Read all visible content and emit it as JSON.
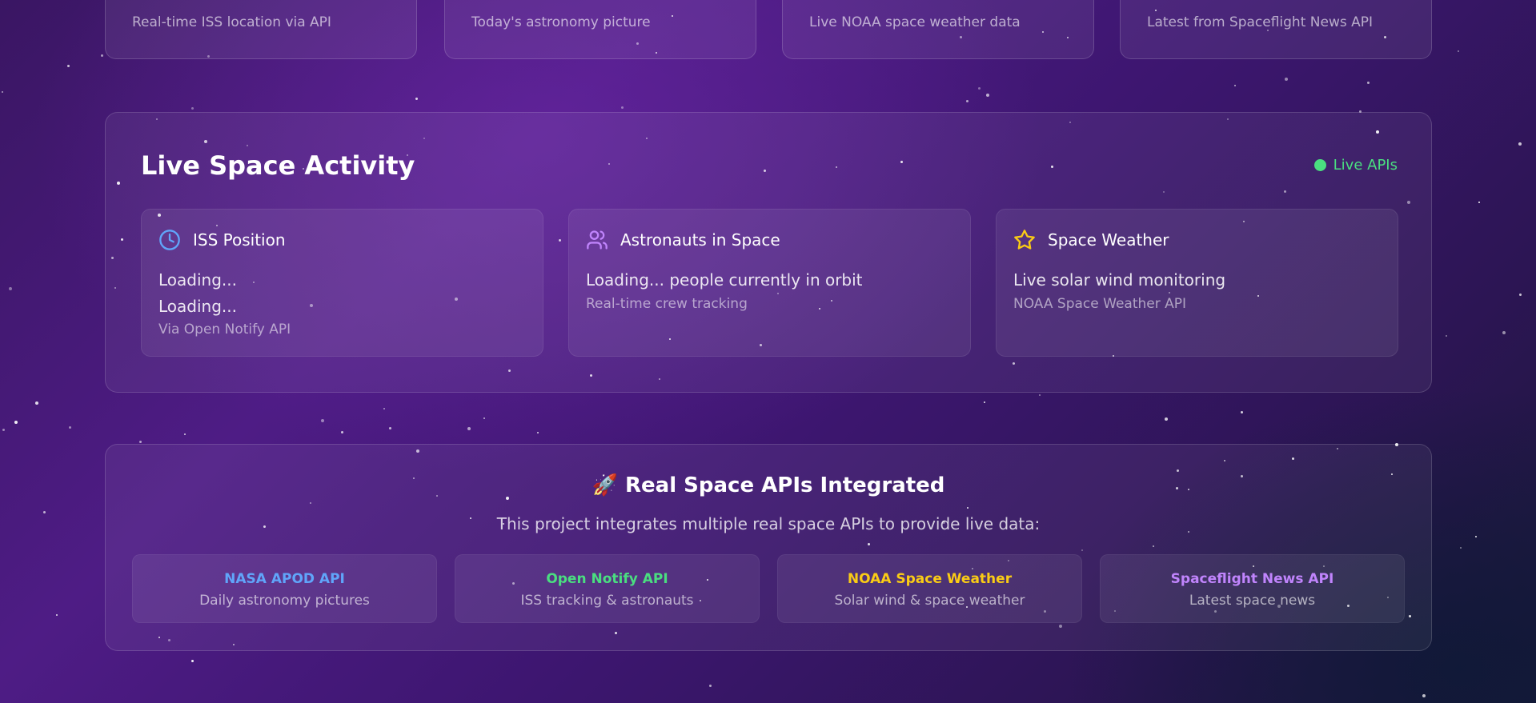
{
  "top_cards": [
    {
      "text": "Real-time ISS location via API"
    },
    {
      "text": "Today's astronomy picture"
    },
    {
      "text": "Live NOAA space weather data"
    },
    {
      "text": "Latest from Spaceflight News API"
    }
  ],
  "activity": {
    "title": "Live Space Activity",
    "badge_label": "Live APIs",
    "badge_color": "#4ade80",
    "cards": [
      {
        "icon": "clock-icon",
        "icon_color": "#60a5fa",
        "title": "ISS Position",
        "line1": "Loading...",
        "line2": "Loading...",
        "source": "Via Open Notify API"
      },
      {
        "icon": "users-icon",
        "icon_color": "#c084fc",
        "title": "Astronauts in Space",
        "line1": "Loading... people currently in orbit",
        "source": "Real-time crew tracking"
      },
      {
        "icon": "star-icon",
        "icon_color": "#facc15",
        "title": "Space Weather",
        "line1": "Live solar wind monitoring",
        "source": "NOAA Space Weather API"
      }
    ]
  },
  "apis": {
    "emoji": "🚀",
    "title": "Real Space APIs Integrated",
    "description": "This project integrates multiple real space APIs to provide live data:",
    "items": [
      {
        "name": "NASA APOD API",
        "desc": "Daily astronomy pictures",
        "color": "#60a5fa"
      },
      {
        "name": "Open Notify API",
        "desc": "ISS tracking & astronauts",
        "color": "#4ade80"
      },
      {
        "name": "NOAA Space Weather",
        "desc": "Solar wind & space weather",
        "color": "#facc15"
      },
      {
        "name": "Spaceflight News API",
        "desc": "Latest space news",
        "color": "#c084fc"
      }
    ]
  }
}
